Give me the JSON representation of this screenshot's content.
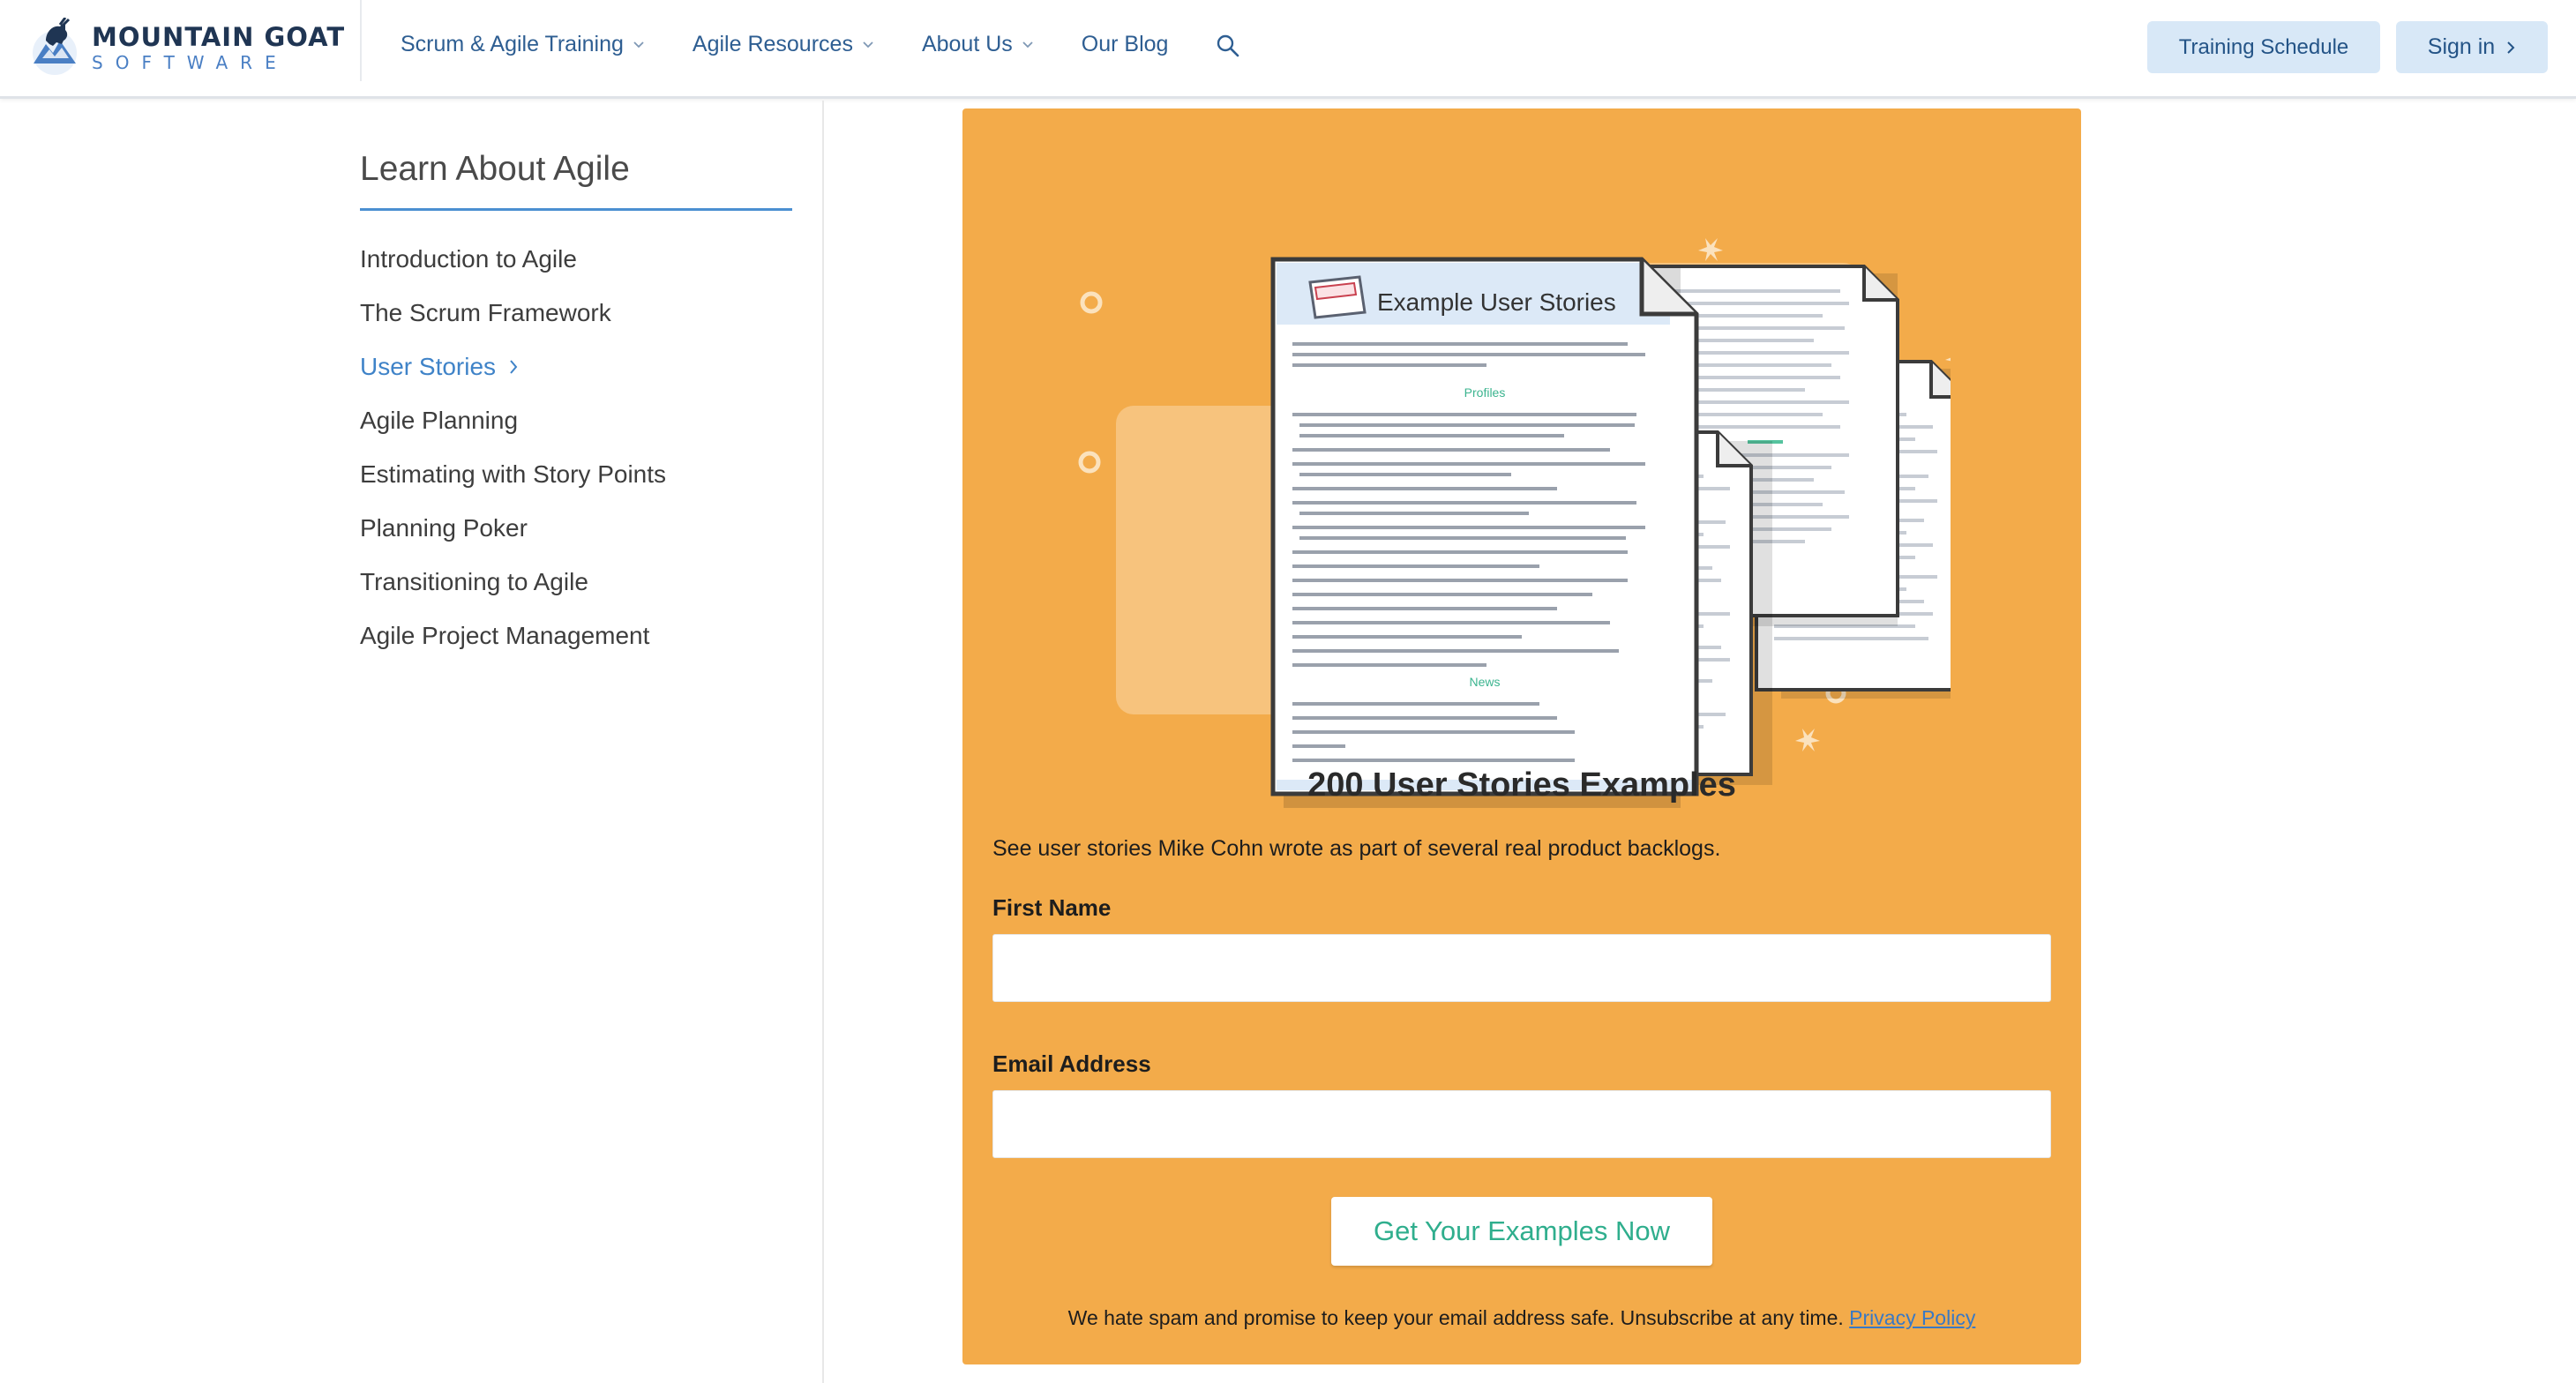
{
  "brand": {
    "line1": "MOUNTAIN GOAT",
    "line2": "SOFTWARE",
    "colors": {
      "navy": "#1f3553",
      "blue": "#4a7fc4"
    }
  },
  "nav": {
    "items": [
      {
        "label": "Scrum & Agile Training",
        "has_dropdown": true
      },
      {
        "label": "Agile Resources",
        "has_dropdown": true
      },
      {
        "label": "About Us",
        "has_dropdown": true
      },
      {
        "label": "Our Blog",
        "has_dropdown": false
      }
    ],
    "search_icon": "search-icon",
    "training_schedule": "Training Schedule",
    "sign_in": "Sign in"
  },
  "sidebar": {
    "title": "Learn About Agile",
    "items": [
      {
        "label": "Introduction to Agile",
        "active": false
      },
      {
        "label": "The Scrum Framework",
        "active": false
      },
      {
        "label": "User Stories",
        "active": true
      },
      {
        "label": "Agile Planning",
        "active": false
      },
      {
        "label": "Estimating with Story Points",
        "active": false
      },
      {
        "label": "Planning Poker",
        "active": false
      },
      {
        "label": "Transitioning to Agile",
        "active": false
      },
      {
        "label": "Agile Project Management",
        "active": false
      }
    ]
  },
  "card": {
    "illustration": {
      "doc_header": "Example User Stories",
      "section_profiles": "Profiles",
      "section_news": "News"
    },
    "title": "200 User Stories Examples",
    "description": "See user stories Mike Cohn wrote as part of several real product backlogs.",
    "first_name_label": "First Name",
    "first_name_value": "",
    "email_label": "Email Address",
    "email_value": "",
    "submit_label": "Get Your Examples Now",
    "spam_text": "We hate spam and promise to keep your email address safe. Unsubscribe at any time.",
    "privacy_link": "Privacy Policy",
    "colors": {
      "card_bg": "#f3ab4a",
      "submit_text": "#2fae8d",
      "accent_blue": "#4b8fd1"
    }
  }
}
